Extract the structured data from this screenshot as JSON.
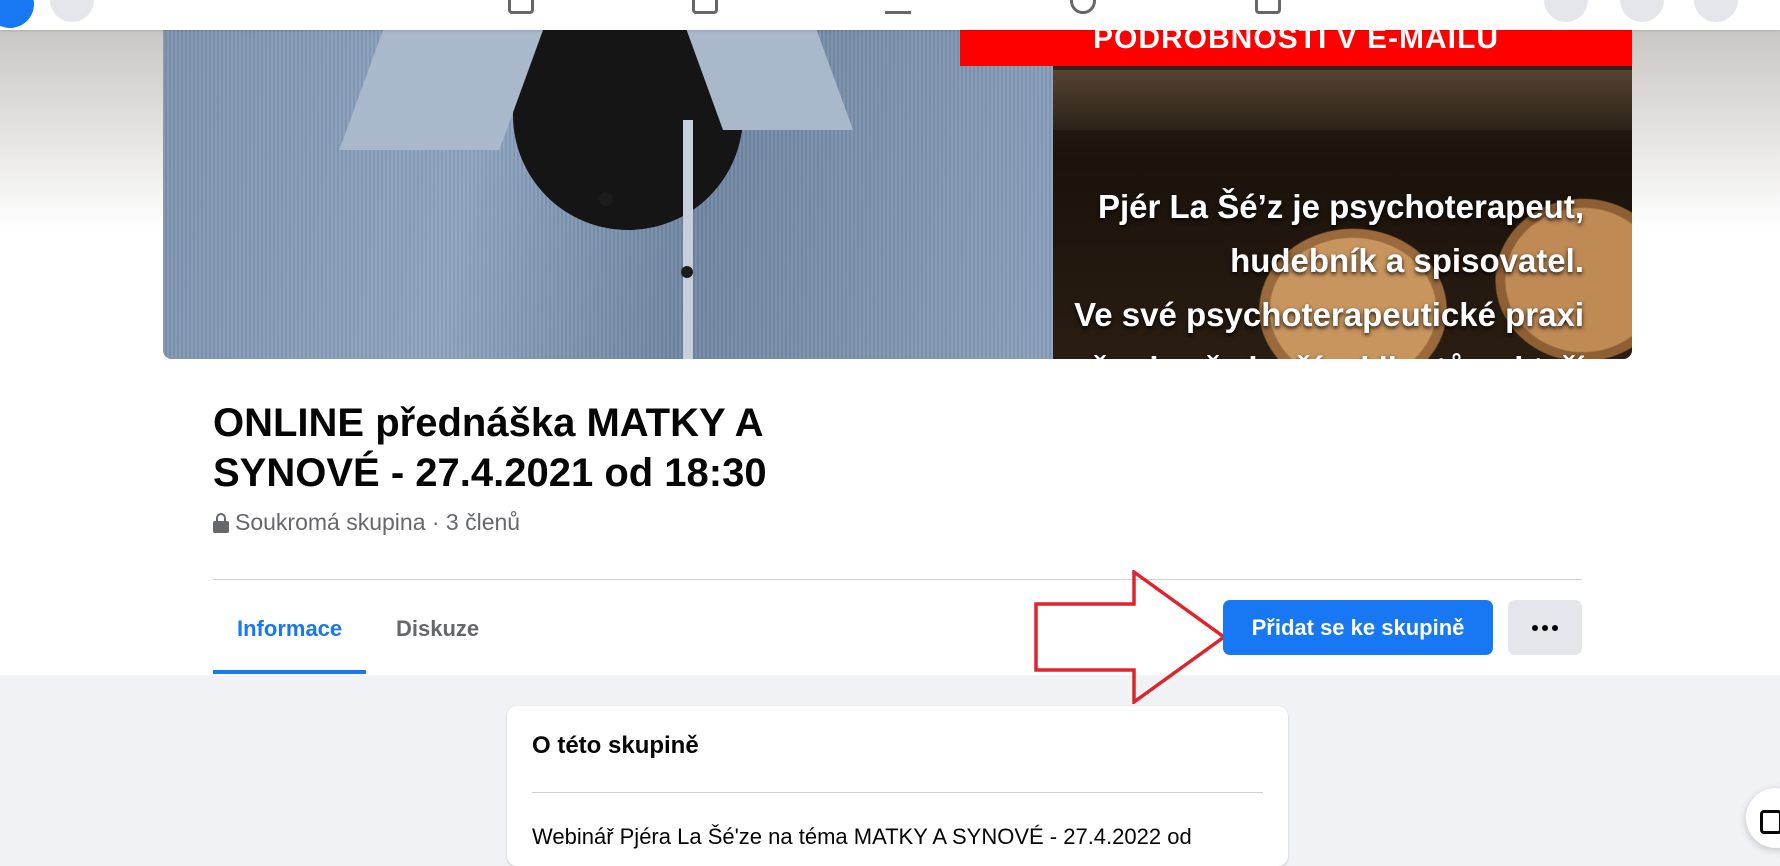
{
  "cover": {
    "banner_text": "PODROBNOSTI V E-MAILU",
    "overlay_lines": [
      "Pjér La Šé’z je psychoterapeut,",
      "hudebník a spisovatel.",
      "Ve své psychoterapeutické praxi",
      "se věnuje především klientům, kteří"
    ]
  },
  "group": {
    "title": "ONLINE přednáška MATKY A SYNOVÉ - 27.4.2021 od 18:30",
    "meta": "Soukromá skupina · 3 členů"
  },
  "tabs": [
    {
      "label": "Informace",
      "active": true
    },
    {
      "label": "Diskuze",
      "active": false
    }
  ],
  "actions": {
    "join_label": "Přidat se ke skupině",
    "join_color": "#1877f2"
  },
  "about": {
    "heading": "O této skupině",
    "description": "Webinář Pjéra La Šé'ze na téma MATKY A SYNOVÉ - 27.4.2022 od"
  },
  "colors": {
    "accent": "#1877f2",
    "annotation_arrow": "#e0242b"
  }
}
